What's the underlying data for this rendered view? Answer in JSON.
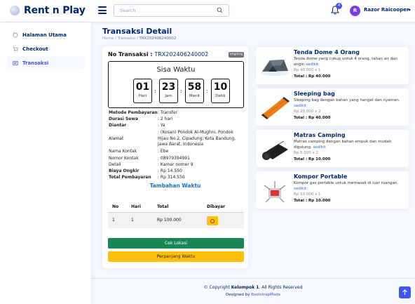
{
  "brand": {
    "name": "Rent n Play"
  },
  "header": {
    "search_placeholder": "Search",
    "notification_count": "4",
    "user_initial": "R",
    "user_name": "Razor Raicooper"
  },
  "sidebar": {
    "items": [
      {
        "label": "Halaman Utama",
        "icon": "grid-icon"
      },
      {
        "label": "Checkout",
        "icon": "cart-icon"
      },
      {
        "label": "Transaksi",
        "icon": "receipt-icon"
      }
    ]
  },
  "page": {
    "title": "Transaksi Detail",
    "breadcrumb": [
      "Home",
      "Transaksi",
      "TRX202406240002"
    ]
  },
  "transaction": {
    "label": "No Transaksi : ",
    "number": "TRX202406240002",
    "status": "ongoing",
    "timer": {
      "title": "Sisa Waktu",
      "days": "01",
      "days_label": "Hari",
      "hours": "23",
      "hours_label": "Jam",
      "minutes": "58",
      "minutes_label": "Menit",
      "seconds": "10",
      "seconds_label": "Detik"
    },
    "details": [
      {
        "key": "Metode Pembayaran",
        "value": ": Transfer",
        "bold": true
      },
      {
        "key": "Durasi Sewa",
        "value": ": 2 hari",
        "bold": true
      },
      {
        "key": "Diantar",
        "value": ": Ya",
        "bold": true
      },
      {
        "key": "Alamat",
        "value": ": (Kosan) Pondok Al-Mughni, Pondok Hijau No.2, Cipadung, Kota Bandung, Jawa Barat, Indonesia",
        "bold": false
      },
      {
        "key": "Nama Kontak",
        "value": ": Ebe",
        "bold": false
      },
      {
        "key": "Nomor Kontak",
        "value": ": 08979394991",
        "bold": false
      },
      {
        "key": "Detail",
        "value": ": Kamar nomer 9",
        "bold": false
      },
      {
        "key": "Biaya Ongkir",
        "value": ": Rp 14.550",
        "bold": true
      },
      {
        "key": "Total Pembayaran",
        "value": ": Rp 314.550",
        "bold": true
      }
    ],
    "extension": {
      "title": "Tambahan Waktu",
      "columns": [
        "No",
        "Hari",
        "Total",
        "Dibayar"
      ],
      "rows": [
        {
          "no": "1",
          "hari": "1",
          "total": "Rp 100.000"
        }
      ]
    },
    "buttons": {
      "location": "Cek Lokasi",
      "extend": "Perpanjang Waktu"
    }
  },
  "products": [
    {
      "name": "Tenda Dome 4 Orang",
      "desc": "Tenda dome yang cukup untuk 4 orang, tahan air dan angin",
      "more": "sedikit",
      "price": "Rp 40.000 x 1",
      "total": "Total : Rp 40.000",
      "image": "tent"
    },
    {
      "name": "Sleeping bag",
      "desc": "Sleeping bag dengan bahan yang hangat dan nyaman.",
      "more": "sedikit",
      "price": "Rp 20.000 x 2",
      "total": "Total : Rp 40.000",
      "image": "sleeping-bag"
    },
    {
      "name": "Matras Camping",
      "desc": "Matras camping dengan bahan empuk dan mudah digulung.",
      "more": "sedikit",
      "price": "Rp 5.000 x 2",
      "total": "Total : Rp 10.000",
      "image": "mat"
    },
    {
      "name": "Kompor Portable",
      "desc": "Kompor gas portable untuk memasak di luar ruangan.",
      "more": "sedikit",
      "price": "Rp 10.000 x 1",
      "total": "Total : Rp 10.000",
      "image": "stove"
    }
  ],
  "footer": {
    "copyright_prefix": "© Copyright ",
    "copyright_owner": "Kelompok 1",
    "copyright_suffix": ". All Rights Reserved",
    "designed_prefix": "Designed by ",
    "designed_by": "BootstrapMade"
  }
}
